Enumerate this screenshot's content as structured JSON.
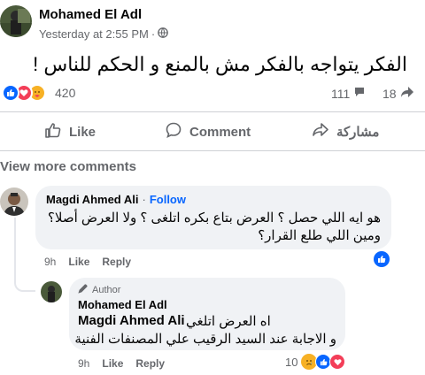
{
  "post": {
    "author": "Mohamed El Adl",
    "timestamp": "Yesterday at 2:55 PM",
    "separator": "·",
    "privacy_icon": "globe-icon",
    "text": "الفكر يتواجه بالفكر مش بالمنع و الحكم للناس !"
  },
  "stats": {
    "reaction_icons": [
      "like-icon",
      "love-icon",
      "care-icon"
    ],
    "reaction_count": "420",
    "comment_count": "111",
    "share_count": "18"
  },
  "actions": {
    "like": "Like",
    "comment": "Comment",
    "share": "مشاركة"
  },
  "view_more_comments": "View more comments",
  "comments": [
    {
      "name": "Magdi Ahmed Ali",
      "dot": "·",
      "follow": "Follow",
      "lines": [
        "هو ايه اللي حصل ؟ العرض بتاع بكره اتلغى ؟ ولا العرض أصلا؟",
        "ومين اللي طلع القرار؟"
      ],
      "time": "9h",
      "like": "Like",
      "reply": "Reply",
      "reaction_icon": "like-icon"
    }
  ],
  "reply": {
    "badge": "Author",
    "name": "Mohamed El Adl",
    "mention": "Magdi Ahmed Ali",
    "line1_text": "اه العرض اتلغي",
    "line2": "و الاجابة عند السيد الرقيب علي المصنفات الفنية",
    "time": "9h",
    "like": "Like",
    "reply": "Reply",
    "reaction_count": "10",
    "reaction_icons": [
      "sad-icon",
      "like-icon",
      "love-icon"
    ]
  },
  "colors": {
    "like_blue": "#0866ff",
    "love_red": "#f33e58",
    "care_yellow": "#f7b125",
    "secondary_text": "#65676b",
    "bubble_bg": "#f0f2f5"
  }
}
